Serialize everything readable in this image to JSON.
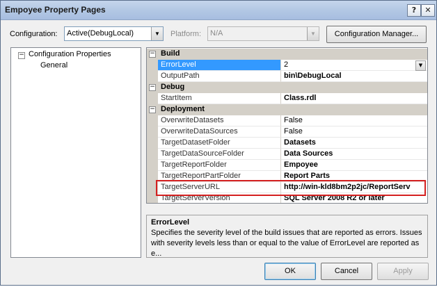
{
  "window": {
    "title": "Empoyee Property Pages",
    "help_glyph": "?",
    "close_glyph": "✕"
  },
  "config": {
    "configuration_label": "Configuration:",
    "configuration_value": "Active(DebugLocal)",
    "platform_label": "Platform:",
    "platform_value": "N/A",
    "manager_button": "Configuration Manager..."
  },
  "tree": {
    "root_expander": "−",
    "root_label": "Configuration Properties",
    "child_label": "General"
  },
  "grid": {
    "categories": {
      "build": "Build",
      "debug": "Debug",
      "deployment": "Deployment"
    },
    "expander": "−",
    "properties": [
      {
        "name": "ErrorLevel",
        "value": "2"
      },
      {
        "name": "OutputPath",
        "value": "bin\\DebugLocal"
      },
      {
        "name": "StartItem",
        "value": "Class.rdl"
      },
      {
        "name": "OverwriteDatasets",
        "value": "False"
      },
      {
        "name": "OverwriteDataSources",
        "value": "False"
      },
      {
        "name": "TargetDatasetFolder",
        "value": "Datasets"
      },
      {
        "name": "TargetDataSourceFolder",
        "value": "Data Sources"
      },
      {
        "name": "TargetReportFolder",
        "value": "Empoyee"
      },
      {
        "name": "TargetReportPartFolder",
        "value": "Report Parts"
      },
      {
        "name": "TargetServerURL",
        "value": "http://win-kld8bm2p2jc/ReportServ"
      },
      {
        "name": "TargetServerVersion",
        "value": "SQL Server 2008 R2 or later"
      }
    ]
  },
  "description": {
    "title": "ErrorLevel",
    "text": "Specifies the severity level of the build issues that are reported as errors. Issues with severity levels less than or equal to the value of ErrorLevel are reported as e..."
  },
  "buttons": {
    "ok": "OK",
    "cancel": "Cancel",
    "apply": "Apply"
  },
  "colors": {
    "selection": "#3399ff",
    "highlight_box": "#d42020",
    "category_band": "#d4d0c8"
  }
}
